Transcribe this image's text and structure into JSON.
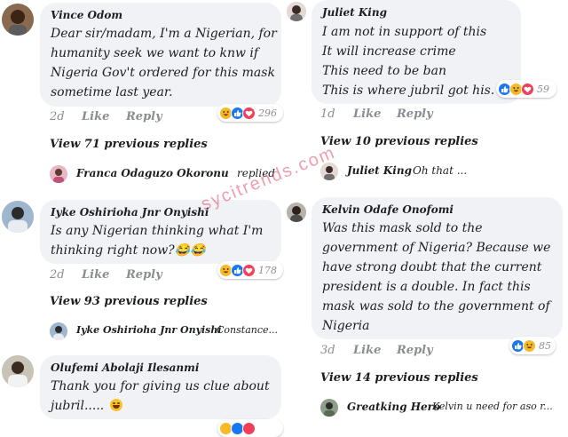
{
  "left": [
    {
      "author": "Vince Odom",
      "lines": [
        "Dear sir/madam, I'm a Nigerian, for",
        "humanity seek we want to knw if",
        "Nigeria Gov't ordered for this mask",
        "sometime last year."
      ],
      "time": "2d",
      "like": "Like",
      "reply": "Reply",
      "reaction_count": "296",
      "view_replies": "View 71 previous replies",
      "last_reply_name": "Franca Odaguzo Okoronu",
      "last_reply_snippet": "replied"
    },
    {
      "author": "Iyke Oshirioha Jnr Onyishi",
      "lines": [
        "Is any Nigerian thinking what I'm",
        "thinking right now?😂😂"
      ],
      "time": "2d",
      "like": "Like",
      "reply": "Reply",
      "reaction_count": "178",
      "view_replies": "View 93 previous replies",
      "last_reply_name": "Iyke Oshirioha Jnr Onyishi",
      "last_reply_snippet": "Constance..."
    },
    {
      "author": "Olufemi Abolaji Ilesanmi",
      "lines": [
        "Thank you for giving us clue about",
        "jubril....."
      ],
      "time": "",
      "like": "",
      "reply": "",
      "reaction_count": "",
      "view_replies": "",
      "last_reply_name": "",
      "last_reply_snippet": ""
    }
  ],
  "right": [
    {
      "author": "Juliet King",
      "lines": [
        "I am not in support of this",
        "It will increase crime",
        "This need to be ban",
        "This is where jubril got his."
      ],
      "time": "1d",
      "like": "Like",
      "reply": "Reply",
      "reaction_count": "59",
      "view_replies": "View 10 previous replies",
      "last_reply_name": "Juliet King",
      "last_reply_snippet": "Oh that ..."
    },
    {
      "author": "Kelvin Odafe Onofomi",
      "lines": [
        "Was this mask sold to the",
        "government of Nigeria? Because we",
        "have strong doubt that the current",
        "president is a double. In fact this",
        "mask was sold to the government of",
        "Nigeria"
      ],
      "time": "3d",
      "like": "Like",
      "reply": "Reply",
      "reaction_count": "85",
      "view_replies": "View 14 previous replies",
      "last_reply_name": "Greatking Hero",
      "last_reply_snippet": "Kelvin u need for aso r..."
    }
  ],
  "watermark": "sycitrends.com",
  "colors": {
    "bubble": "#f0f2f5",
    "like": "#1877f2",
    "haha": "#f7b928",
    "love": "#f33e58",
    "meta": "#8a8d91"
  }
}
